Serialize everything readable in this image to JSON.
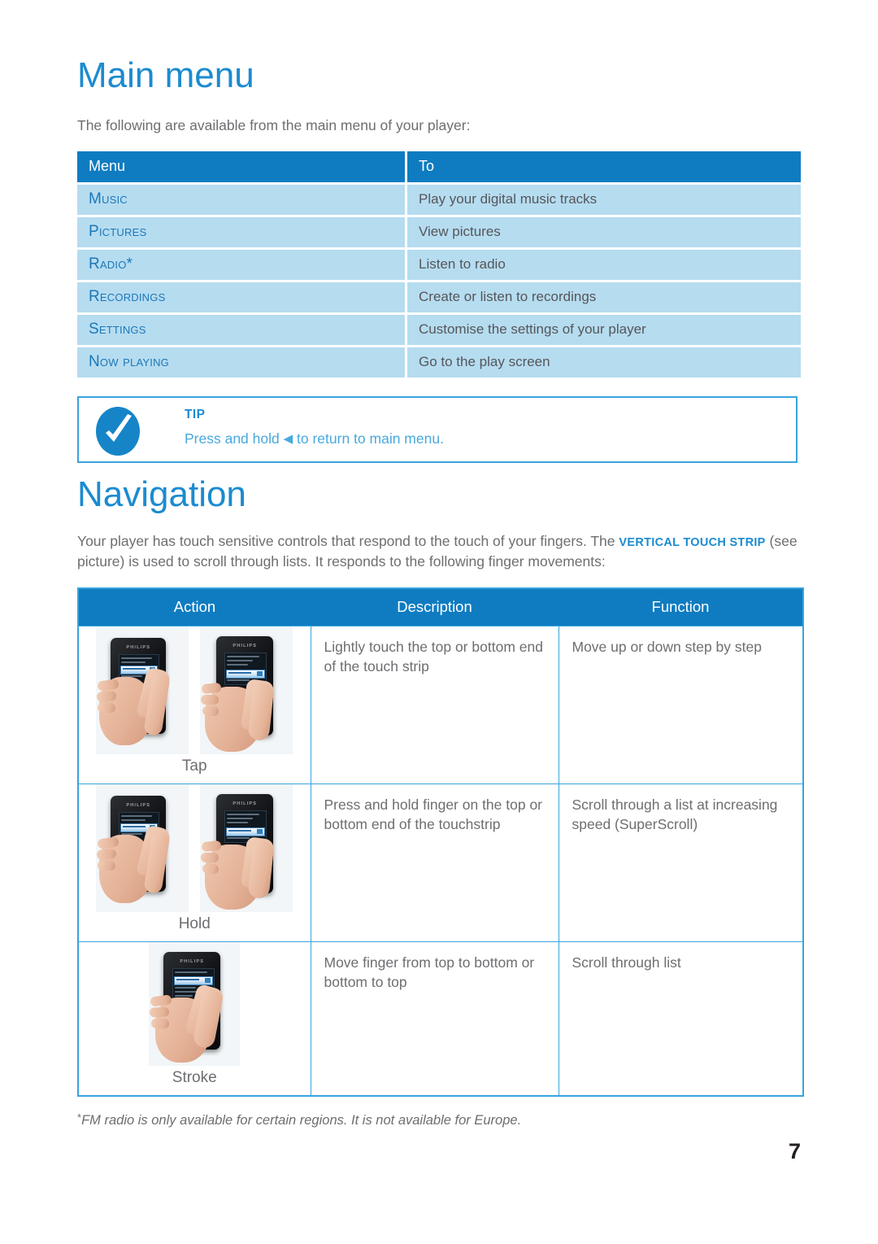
{
  "document": {
    "page_number": "7"
  },
  "main_menu": {
    "heading": "Main menu",
    "intro": "The following are available from the main menu of your player:",
    "table": {
      "headers": [
        "Menu",
        "To"
      ],
      "rows": [
        {
          "menu": "Music",
          "to": "Play your digital music tracks"
        },
        {
          "menu": "Pictures",
          "to": "View pictures"
        },
        {
          "menu": "Radio*",
          "to": "Listen to radio"
        },
        {
          "menu": "Recordings",
          "to": "Create or listen to recordings"
        },
        {
          "menu": "Settings",
          "to": "Customise the settings of your player"
        },
        {
          "menu": "Now playing",
          "to": "Go to the play screen"
        }
      ]
    }
  },
  "tip": {
    "icon": "checkmark-oval-icon",
    "label": "TIP",
    "text_before": "Press and hold ",
    "arrow": "◀",
    "text_after": " to return to main menu."
  },
  "navigation": {
    "heading": "Navigation",
    "intro_part1": "Your player has touch sensitive controls that respond to the touch of your fingers. The ",
    "intro_highlight": "VERTICAL TOUCH STRIP",
    "intro_part2": " (see picture) is used to scroll through lists. It responds to the following finger movements:",
    "table": {
      "headers": [
        "Action",
        "Description",
        "Function"
      ],
      "rows": [
        {
          "action_label": "Tap",
          "photos": 2,
          "description": "Lightly touch the top or bottom end of the touch strip",
          "function": "Move up or down step by step"
        },
        {
          "action_label": "Hold",
          "photos": 2,
          "description": "Press and hold finger on the top or bottom end of the touchstrip",
          "function": "Scroll through a list at increasing speed (SuperScroll)"
        },
        {
          "action_label": "Stroke",
          "photos": 1,
          "description": "Move finger from top to bottom or bottom to top",
          "function": "Scroll through list"
        }
      ]
    }
  },
  "footnote": {
    "marker": "*",
    "text": "FM radio is only available for certain regions. It is not available for Europe."
  },
  "colors": {
    "heading_blue": "#1b8bd0",
    "table_header_blue": "#0f7cc1",
    "row_light_blue": "#b6dcf0",
    "menu_text_blue": "#1b78b8",
    "border_blue": "#39a4dd",
    "body_gray": "#6d6e71",
    "arrow_red": "#e8412a"
  }
}
